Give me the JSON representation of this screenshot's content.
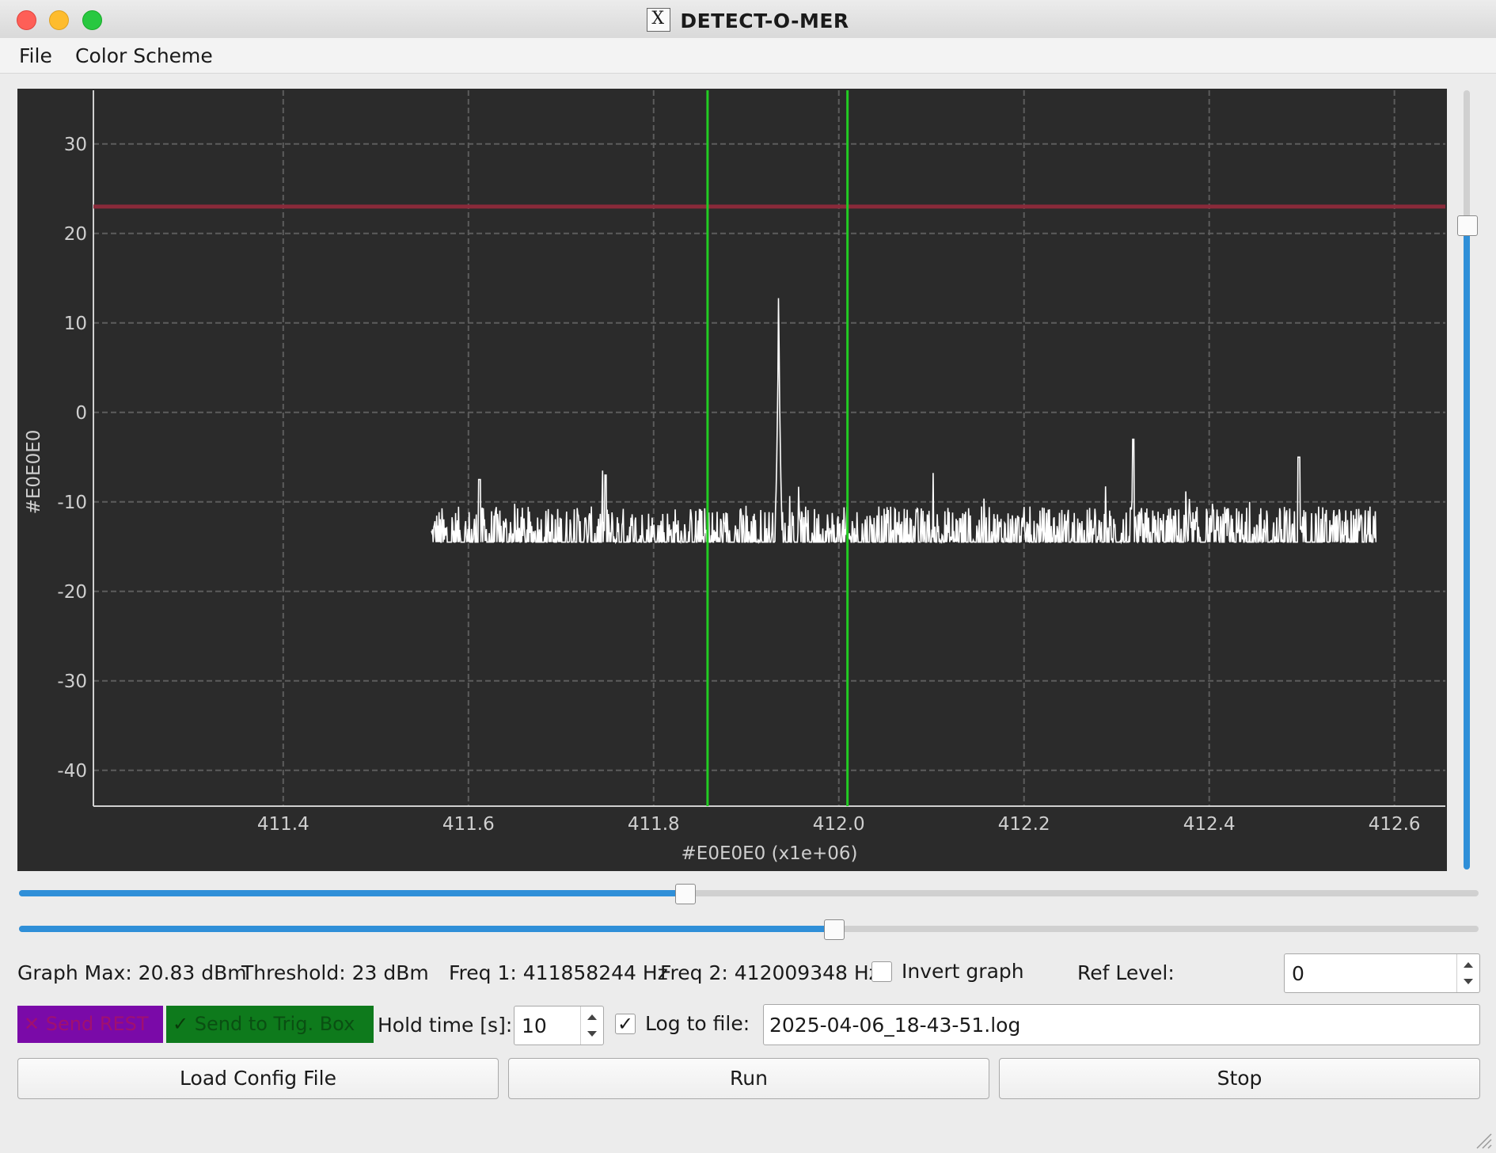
{
  "window": {
    "title": "DETECT-O-MER"
  },
  "menu": {
    "items": [
      "File",
      "Color Scheme"
    ]
  },
  "chart_data": {
    "type": "line",
    "xlabel": "#E0E0E0 (x1e+06)",
    "ylabel": "#E0E0E0",
    "xlim": [
      411.195,
      412.655
    ],
    "ylim": [
      -44,
      36
    ],
    "x_ticks": [
      "411.4",
      "411.6",
      "411.8",
      "412.0",
      "412.2",
      "412.4",
      "412.6"
    ],
    "y_ticks": [
      "30",
      "20",
      "10",
      "0",
      "-10",
      "-20",
      "-30",
      "-40"
    ],
    "grid": true,
    "threshold_line": {
      "value": 23,
      "color": "#8a2a3a"
    },
    "markers": [
      {
        "name": "Freq 1",
        "value": 411.858244,
        "color": "#22cc22"
      },
      {
        "name": "Freq 2",
        "value": 412.009348,
        "color": "#22cc22"
      }
    ],
    "series": [
      {
        "color": "#ffffff",
        "x_range": [
          411.56,
          412.58
        ],
        "noise_floor": -14.5,
        "noise_spread": 4,
        "peaks": [
          {
            "x": 411.935,
            "y": 20.83
          },
          {
            "x": 411.748,
            "y": -7
          },
          {
            "x": 412.318,
            "y": -3
          },
          {
            "x": 412.497,
            "y": -5
          },
          {
            "x": 411.612,
            "y": -7.5
          }
        ]
      }
    ]
  },
  "sliders": {
    "vertical_level": 0.83,
    "horizontal_1": 0.456,
    "horizontal_2": 0.558
  },
  "status": {
    "graph_max": "Graph Max: 20.83 dBm",
    "threshold": "Threshold: 23 dBm",
    "freq1": "Freq 1: 411858244 Hz",
    "freq2": "Freq 2: 412009348 Hz",
    "invert_label": "Invert graph",
    "invert_checked": false,
    "ref_label": "Ref Level:",
    "ref_value": "0"
  },
  "controls": {
    "send_rest": {
      "label": "Send REST",
      "checked": false,
      "color": "#7a0aa8",
      "text_color": "#a01070"
    },
    "send_trig": {
      "label": "Send to Trig. Box",
      "checked": true,
      "color": "#0e7a1c",
      "text_color": "#0a4f12"
    },
    "hold_label": "Hold time [s]:",
    "hold_value": "10",
    "log_label": "Log to file:",
    "log_checked": true,
    "log_file": "2025-04-06_18-43-51.log"
  },
  "buttons": {
    "load": "Load Config File",
    "run": "Run",
    "stop": "Stop"
  },
  "icons": {
    "app": "x11-icon",
    "check": "checkmark-icon"
  }
}
